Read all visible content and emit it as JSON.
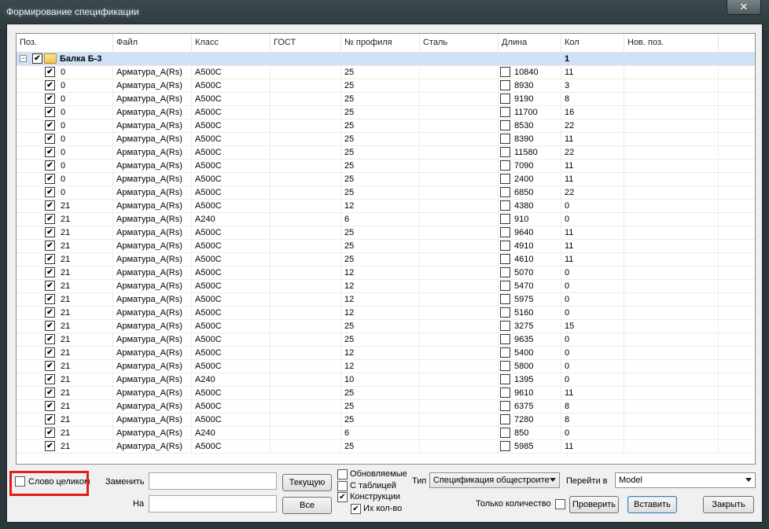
{
  "window": {
    "title": "Формирование спецификации",
    "close_glyph": "✕"
  },
  "columns": [
    "Поз.",
    "Файл",
    "Класс",
    "ГОСТ",
    "№ профиля",
    "Сталь",
    "Длина",
    "Кол",
    "Нов. поз."
  ],
  "group": {
    "expander": "−",
    "label": "Балка Б-3",
    "count": "1"
  },
  "rows": [
    {
      "pos": "0",
      "file": "Арматура_A(Rs)",
      "cls": "А500С",
      "profile": "25",
      "length": "10840",
      "qty": "11"
    },
    {
      "pos": "0",
      "file": "Арматура_A(Rs)",
      "cls": "А500С",
      "profile": "25",
      "length": "8930",
      "qty": "3"
    },
    {
      "pos": "0",
      "file": "Арматура_A(Rs)",
      "cls": "А500С",
      "profile": "25",
      "length": "9190",
      "qty": "8"
    },
    {
      "pos": "0",
      "file": "Арматура_A(Rs)",
      "cls": "А500С",
      "profile": "25",
      "length": "11700",
      "qty": "16"
    },
    {
      "pos": "0",
      "file": "Арматура_A(Rs)",
      "cls": "А500С",
      "profile": "25",
      "length": "8530",
      "qty": "22"
    },
    {
      "pos": "0",
      "file": "Арматура_A(Rs)",
      "cls": "А500С",
      "profile": "25",
      "length": "8390",
      "qty": "11"
    },
    {
      "pos": "0",
      "file": "Арматура_A(Rs)",
      "cls": "А500С",
      "profile": "25",
      "length": "11580",
      "qty": "22"
    },
    {
      "pos": "0",
      "file": "Арматура_A(Rs)",
      "cls": "А500С",
      "profile": "25",
      "length": "7090",
      "qty": "11"
    },
    {
      "pos": "0",
      "file": "Арматура_A(Rs)",
      "cls": "А500С",
      "profile": "25",
      "length": "2400",
      "qty": "11"
    },
    {
      "pos": "0",
      "file": "Арматура_A(Rs)",
      "cls": "А500С",
      "profile": "25",
      "length": "6850",
      "qty": "22"
    },
    {
      "pos": "21",
      "file": "Арматура_A(Rs)",
      "cls": "А500С",
      "profile": "12",
      "length": "4380",
      "qty": "0"
    },
    {
      "pos": "21",
      "file": "Арматура_A(Rs)",
      "cls": "А240",
      "profile": "6",
      "length": "910",
      "qty": "0"
    },
    {
      "pos": "21",
      "file": "Арматура_A(Rs)",
      "cls": "А500С",
      "profile": "25",
      "length": "9640",
      "qty": "11"
    },
    {
      "pos": "21",
      "file": "Арматура_A(Rs)",
      "cls": "А500С",
      "profile": "25",
      "length": "4910",
      "qty": "11"
    },
    {
      "pos": "21",
      "file": "Арматура_A(Rs)",
      "cls": "А500С",
      "profile": "25",
      "length": "4610",
      "qty": "11"
    },
    {
      "pos": "21",
      "file": "Арматура_A(Rs)",
      "cls": "А500С",
      "profile": "12",
      "length": "5070",
      "qty": "0"
    },
    {
      "pos": "21",
      "file": "Арматура_A(Rs)",
      "cls": "А500С",
      "profile": "12",
      "length": "5470",
      "qty": "0"
    },
    {
      "pos": "21",
      "file": "Арматура_A(Rs)",
      "cls": "А500С",
      "profile": "12",
      "length": "5975",
      "qty": "0"
    },
    {
      "pos": "21",
      "file": "Арматура_A(Rs)",
      "cls": "А500С",
      "profile": "12",
      "length": "5160",
      "qty": "0"
    },
    {
      "pos": "21",
      "file": "Арматура_A(Rs)",
      "cls": "А500С",
      "profile": "25",
      "length": "3275",
      "qty": "15"
    },
    {
      "pos": "21",
      "file": "Арматура_A(Rs)",
      "cls": "А500С",
      "profile": "25",
      "length": "9635",
      "qty": "0"
    },
    {
      "pos": "21",
      "file": "Арматура_A(Rs)",
      "cls": "А500С",
      "profile": "12",
      "length": "5400",
      "qty": "0"
    },
    {
      "pos": "21",
      "file": "Арматура_A(Rs)",
      "cls": "А500С",
      "profile": "12",
      "length": "5800",
      "qty": "0"
    },
    {
      "pos": "21",
      "file": "Арматура_A(Rs)",
      "cls": "А240",
      "profile": "10",
      "length": "1395",
      "qty": "0"
    },
    {
      "pos": "21",
      "file": "Арматура_A(Rs)",
      "cls": "А500С",
      "profile": "25",
      "length": "9610",
      "qty": "11"
    },
    {
      "pos": "21",
      "file": "Арматура_A(Rs)",
      "cls": "А500С",
      "profile": "25",
      "length": "6375",
      "qty": "8"
    },
    {
      "pos": "21",
      "file": "Арматура_A(Rs)",
      "cls": "А500С",
      "profile": "25",
      "length": "7280",
      "qty": "8"
    },
    {
      "pos": "21",
      "file": "Арматура_A(Rs)",
      "cls": "А240",
      "profile": "6",
      "length": "850",
      "qty": "0"
    },
    {
      "pos": "21",
      "file": "Арматура_A(Rs)",
      "cls": "А500С",
      "profile": "25",
      "length": "5985",
      "qty": "11"
    }
  ],
  "controls": {
    "whole_word_label": "Слово целиком",
    "replace_label": "Заменить",
    "current_button": "Текущую",
    "to_label": "На",
    "all_button": "Все",
    "updatable_label": "Обновляемые",
    "with_table_label": "С таблицей",
    "constructions_label": "Конструкции",
    "their_qty_label": "Их кол-во",
    "type_label": "Тип",
    "type_value": "Спецификация общестроите",
    "goto_label": "Перейти в",
    "goto_value": "Model",
    "only_qty_label": "Только количество",
    "check_button": "Проверить",
    "insert_button": "Вставить",
    "close_button": "Закрыть"
  }
}
